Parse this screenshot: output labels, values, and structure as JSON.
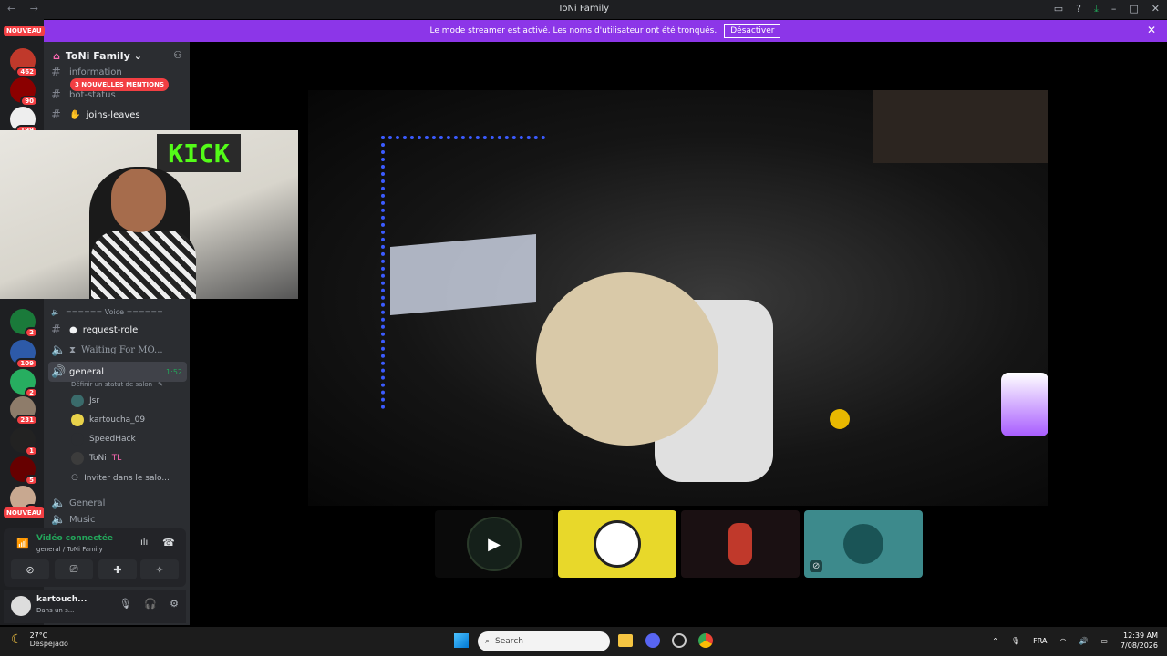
{
  "window": {
    "title": "ToNi Family",
    "nav": "← →"
  },
  "banner": {
    "text": "Le mode streamer est activé. Les noms d'utilisateur ont été tronqués.",
    "button": "Désactiver"
  },
  "rail": {
    "nouveau_top": "NOUVEAU",
    "nouveau_bottom": "NOUVEAU",
    "badges": [
      "462",
      "90",
      "199",
      "2",
      "109",
      "2",
      "231",
      "1",
      "5",
      "1"
    ]
  },
  "server": {
    "name": "ToNi Family"
  },
  "mentions": "3 NOUVELLES MENTIONS",
  "channels": {
    "information": "information",
    "bot_status": "bot-status",
    "joins_leaves": "joins-leaves",
    "voice_divider": "====== Voice ======",
    "request_role": "request-role",
    "waiting": "Waiting For MO...",
    "general_voice": "general",
    "general_time": "1:52",
    "status_hint": "Définir un statut de salon",
    "invite": "Inviter dans le salo...",
    "general2": "General",
    "music": "Music"
  },
  "members": [
    "Jsr",
    "kartoucha_09",
    "SpeedHack",
    "ToNi",
    "TL"
  ],
  "voice_panel": {
    "title": "Vidéo connectée",
    "subtitle": "general / ToNi Family"
  },
  "user": {
    "name": "kartouch...",
    "status": "Dans un s..."
  },
  "camera": {
    "sign": "KICK"
  },
  "taskbar": {
    "temp": "27°C",
    "weather": "Despejado",
    "search_placeholder": "Search",
    "lang": "FRA",
    "time": "12:39 AM",
    "date": "7/08/2026"
  }
}
